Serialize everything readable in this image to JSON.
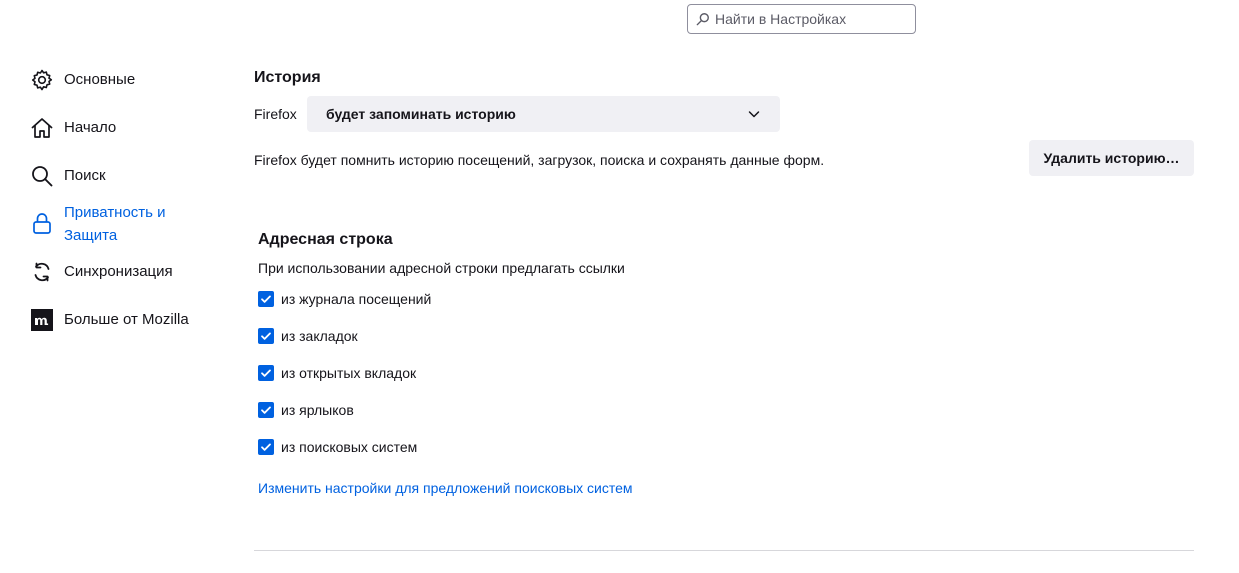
{
  "search": {
    "placeholder": "Найти в Настройках",
    "icon": "search-icon"
  },
  "sidebar": {
    "items": [
      {
        "label": "Основные",
        "icon": "gear-icon"
      },
      {
        "label": "Начало",
        "icon": "home-icon"
      },
      {
        "label": "Поиск",
        "icon": "search-icon"
      },
      {
        "label": "Приватность и Защита",
        "icon": "lock-icon",
        "selected": true
      },
      {
        "label": "Синхронизация",
        "icon": "sync-icon"
      },
      {
        "label": "Больше от Mozilla",
        "icon": "mozilla-logo-icon"
      }
    ]
  },
  "history": {
    "title": "История",
    "prefix": "Firefox",
    "mode_value": "будет запоминать историю",
    "description": "Firefox будет помнить историю посещений, загрузок, поиска и сохранять данные форм.",
    "clear_button": "Удалить историю…"
  },
  "addressbar": {
    "title": "Адресная строка",
    "subtitle": "При использовании адресной строки предлагать ссылки",
    "options": [
      {
        "label": "из журнала посещений",
        "checked": true
      },
      {
        "label": "из закладок",
        "checked": true
      },
      {
        "label": "из открытых вкладок",
        "checked": true
      },
      {
        "label": "из ярлыков",
        "checked": true
      },
      {
        "label": "из поисковых систем",
        "checked": true
      }
    ],
    "link": "Изменить настройки для предложений поисковых систем"
  },
  "colors": {
    "accent": "#0061e0",
    "text": "#15141a",
    "button_bg": "#f0f0f4"
  }
}
